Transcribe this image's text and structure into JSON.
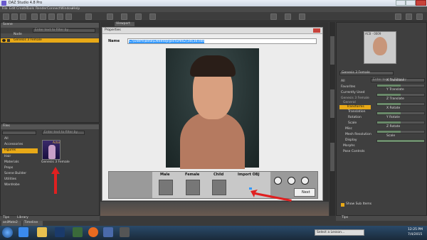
{
  "window": {
    "title": "DAZ Studio 4.8 Pro"
  },
  "menu": [
    "File",
    "Edit",
    "Create",
    "Tools",
    "Render",
    "Connect",
    "Window",
    "Help"
  ],
  "left_panel": {
    "tab": "Scene",
    "search_placeholder": "Enter text to filter by",
    "header": "Node",
    "selected_node": "Genesis 3 Female"
  },
  "files_panel": {
    "tab": "Files",
    "search_placeholder": "Enter text to filter by",
    "categories": [
      "All",
      "Accessories",
      "Figures",
      "Hair",
      "Materials",
      "Props",
      "Scene Builder",
      "Utilities",
      "Wardrobe"
    ],
    "selected_category": "Figures",
    "thumb_label": "Genesis 3 Female",
    "thumb_badge": "Actor",
    "footer_tabs": [
      "Tips",
      "Library"
    ]
  },
  "viewport": {
    "tab": "Viewport"
  },
  "dialog": {
    "title": "Properties",
    "name_label": "Name",
    "path_value": "C:\\Users\\asta\\Desktop\\pictures2\\3d\\3d.tds",
    "options": [
      {
        "label": "Male"
      },
      {
        "label": "Female"
      },
      {
        "label": "Child"
      },
      {
        "label": "Import OBJ"
      }
    ],
    "next_button": "Next"
  },
  "right_panel": {
    "preview_title": "ACB - 0009",
    "selector": "Genesis 3 Female",
    "search_placeholder": "Enter text to filter by",
    "filters": [
      "All",
      "Favorites",
      "Currently Used"
    ],
    "tree": [
      "Genesis 3 Female",
      "General",
      "Transforms",
      "Translation",
      "Rotation",
      "Scale",
      "Misc",
      "Mesh Resolution",
      "Display",
      "Morphs",
      "Pose Controls"
    ],
    "selected_tree": "Transforms",
    "sliders": [
      {
        "label": "X Translate",
        "value": "0.00"
      },
      {
        "label": "Y Translate",
        "value": "0.00"
      },
      {
        "label": "Z Translate",
        "value": "0.00"
      },
      {
        "label": "X Rotate",
        "value": "0.00"
      },
      {
        "label": "Y Rotate",
        "value": "0.00"
      },
      {
        "label": "Z Rotate",
        "value": "0.00"
      },
      {
        "label": "Scale",
        "value": "100%"
      }
    ],
    "checkbox": "Show Sub Items",
    "footer_tab": "Tips"
  },
  "side_tabs": [
    "Parameters",
    "Content Library",
    "Scene",
    "Surfaces"
  ],
  "bottom_tabs": [
    "aniMate2",
    "Timeline"
  ],
  "taskbar": {
    "apps": [
      "start",
      "ie",
      "explorer",
      "photoshop",
      "media",
      "firefox",
      "uac",
      "daz",
      "terminal"
    ],
    "select_lesson": "Select a Lesson...",
    "time": "12:25 PM",
    "date": "7/4/2015"
  },
  "colors": {
    "accent": "#e8a917",
    "arrow": "#e02020",
    "highlight": "#3399ff"
  }
}
